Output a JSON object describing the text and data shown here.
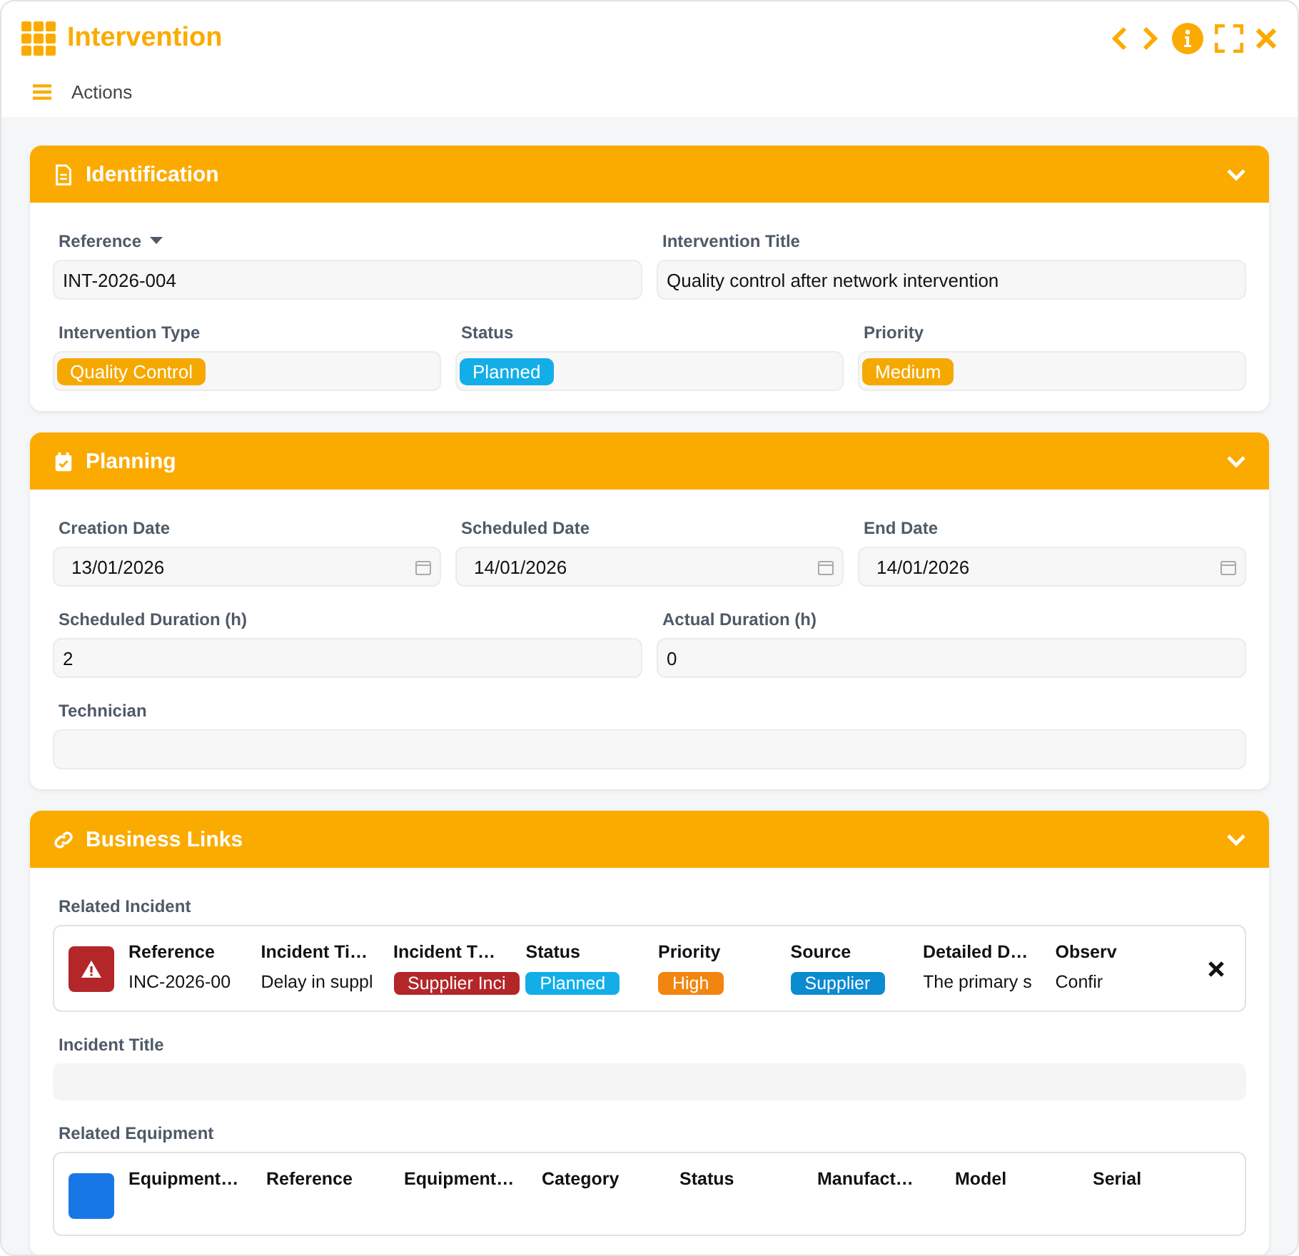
{
  "window": {
    "title": "Intervention"
  },
  "toolbar": {
    "actions_label": "Actions"
  },
  "sections": [
    {
      "title": "Identification",
      "expanded": true,
      "rows": [
        {
          "fields": [
            {
              "label": "Reference",
              "kind": "text",
              "value": "INT-2026-004",
              "has_dropdown": true
            },
            {
              "label": "Intervention Title",
              "kind": "text",
              "value": "Quality control after network intervention"
            }
          ]
        },
        {
          "fields": [
            {
              "label": "Intervention Type",
              "kind": "tag",
              "value": "Quality Control",
              "color": "#f5a800"
            },
            {
              "label": "Status",
              "kind": "tag",
              "value": "Planned",
              "color": "#13aee8"
            },
            {
              "label": "Priority",
              "kind": "tag",
              "value": "Medium",
              "color": "#f5a800"
            }
          ]
        }
      ]
    },
    {
      "title": "Planning",
      "expanded": true,
      "rows": [
        {
          "fields": [
            {
              "label": "Creation Date",
              "kind": "date",
              "value": "13/01/2026"
            },
            {
              "label": "Scheduled Date",
              "kind": "date",
              "value": "14/01/2026"
            },
            {
              "label": "End Date",
              "kind": "date",
              "value": "14/01/2026"
            }
          ]
        },
        {
          "fields": [
            {
              "label": "Scheduled Duration (h)",
              "kind": "text",
              "value": "2"
            },
            {
              "label": "Actual Duration (h)",
              "kind": "text",
              "value": "0"
            }
          ]
        },
        {
          "fields": [
            {
              "label": "Technician",
              "kind": "text"
            }
          ]
        }
      ]
    },
    {
      "title": "Business Links",
      "expanded": true,
      "blocks": [
        {
          "kind": "record",
          "label": "Related Incident",
          "color": "#b3262a",
          "removable": true,
          "columns": [
            {
              "header": "Reference",
              "value": "INC-2026-00"
            },
            {
              "header": "Incident Ti…",
              "value": "Delay in suppl"
            },
            {
              "header": "Incident T…",
              "value": "Supplier Inci",
              "color": "#b3262a"
            },
            {
              "header": "Status",
              "value": "Planned",
              "color": "#13aee8"
            },
            {
              "header": "Priority",
              "value": "High",
              "color": "#f2850f"
            },
            {
              "header": "Source",
              "value": "Supplier",
              "color": "#0b8bd0"
            },
            {
              "header": "Detailed D…",
              "value": "The primary s"
            },
            {
              "header": "Observ",
              "value": "Confir"
            }
          ]
        },
        {
          "kind": "field",
          "label": "Incident Title"
        },
        {
          "kind": "record",
          "label": "Related Equipment",
          "color": "#1877e6",
          "removable": false,
          "columns": [
            {
              "header": "Equipment…"
            },
            {
              "header": "Reference"
            },
            {
              "header": "Equipment…"
            },
            {
              "header": "Category"
            },
            {
              "header": "Status"
            },
            {
              "header": "Manufact…"
            },
            {
              "header": "Model"
            },
            {
              "header": "Serial"
            }
          ]
        }
      ]
    }
  ]
}
